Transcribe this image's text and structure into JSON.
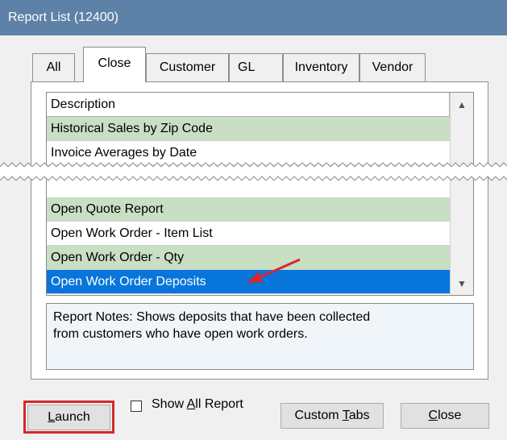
{
  "window": {
    "title": "Report List (12400)"
  },
  "tabs": [
    {
      "label": "All"
    },
    {
      "label": "Close"
    },
    {
      "label": "Customer"
    },
    {
      "label": "GL"
    },
    {
      "label": "Inventory"
    },
    {
      "label": "Vendor"
    }
  ],
  "active_tab": "Close",
  "list": {
    "header": "Description",
    "rows": [
      "Historical Sales by Zip Code",
      "Invoice Averages by Date",
      "Open Quote Report",
      "Open Work Order - Item List",
      "Open Work Order - Qty",
      "Open Work Order Deposits"
    ],
    "selected": "Open Work Order Deposits"
  },
  "notes": {
    "line1": "Report Notes:  Shows deposits that have been collected",
    "line2": "from customers who have open work orders."
  },
  "buttons": {
    "launch": "Launch",
    "launch_rest": "aunch",
    "launch_accel": "L",
    "show_all_pre": "Show ",
    "show_all_accel": "A",
    "show_all_post": "ll Report",
    "custom_tabs_pre": "Custom ",
    "custom_tabs_accel": "T",
    "custom_tabs_post": "abs",
    "close_accel": "C",
    "close_post": "lose"
  },
  "colors": {
    "titlebar": "#5e81a7",
    "row_green": "#c8dfc4",
    "selection": "#0875db",
    "highlight_red": "#d4282e"
  }
}
